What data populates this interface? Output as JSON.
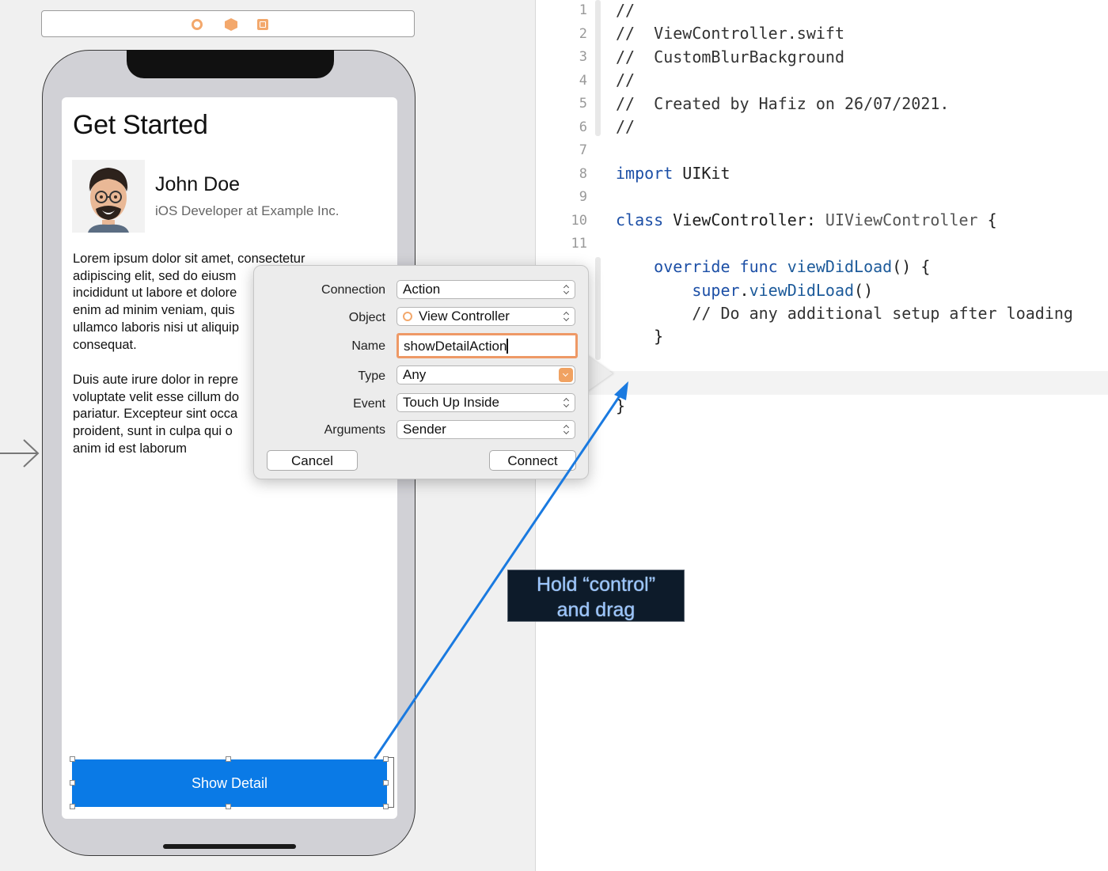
{
  "storyboard": {
    "scene_dock": {
      "icons": [
        "view-controller-icon",
        "first-responder-icon",
        "exit-icon"
      ]
    },
    "screen": {
      "title": "Get Started",
      "profile": {
        "name": "John Doe",
        "subtitle": "iOS Developer at Example Inc."
      },
      "paragraph_1": "Lorem ipsum dolor sit amet, consectetur\nadipiscing elit, sed do eiusm\nincididunt ut labore et dolore\nenim ad minim veniam, quis\nullamco laboris nisi ut aliquip\nconsequat.",
      "paragraph_2": "Duis aute irure dolor in repre\nvoluptate velit esse cillum do\npariatur. Excepteur sint occa\nproident, sunt in culpa qui o\nanim id est laborum",
      "button_label": "Show Detail"
    }
  },
  "connection_popover": {
    "connection": {
      "label": "Connection",
      "value": "Action"
    },
    "object": {
      "label": "Object",
      "value": "View Controller"
    },
    "name": {
      "label": "Name",
      "value": "showDetailAction"
    },
    "type": {
      "label": "Type",
      "value": "Any"
    },
    "event": {
      "label": "Event",
      "value": "Touch Up Inside"
    },
    "arguments": {
      "label": "Arguments",
      "value": "Sender"
    },
    "cancel_label": "Cancel",
    "connect_label": "Connect"
  },
  "editor": {
    "line_numbers": [
      "1",
      "2",
      "3",
      "4",
      "5",
      "6",
      "7",
      "8",
      "9",
      "10",
      "11"
    ],
    "lines": {
      "l1": "//",
      "l2": "//  ViewController.swift",
      "l3": "//  CustomBlurBackground",
      "l4": "//",
      "l5": "//  Created by Hafiz on 26/07/2021.",
      "l6": "//",
      "l8_kw": "import",
      "l8_rest": " UIKit",
      "l10_kw": "class",
      "l10_name": " ViewController: ",
      "l10_type": "UIViewController",
      "l10_rest": " {",
      "l12_indent": "    ",
      "l12_kw1": "override",
      "l12_sp": " ",
      "l12_kw2": "func",
      "l12_fn": " viewDidLoad",
      "l12_rest": "() {",
      "l13_indent": "        ",
      "l13_kw": "super",
      "l13_dot": ".",
      "l13_fn": "viewDidLoad",
      "l13_rest": "()",
      "l14": "        // Do any additional setup after loading",
      "l15": "    }",
      "l17": "}"
    }
  },
  "annotation": {
    "instruction": "Hold “control”\nand drag"
  },
  "colors": {
    "accent_blue": "#0a7ae6",
    "focus_orange": "#ee9966",
    "keyword_blue": "#1c4fa6",
    "annotation_text": "#9bc6ff"
  }
}
